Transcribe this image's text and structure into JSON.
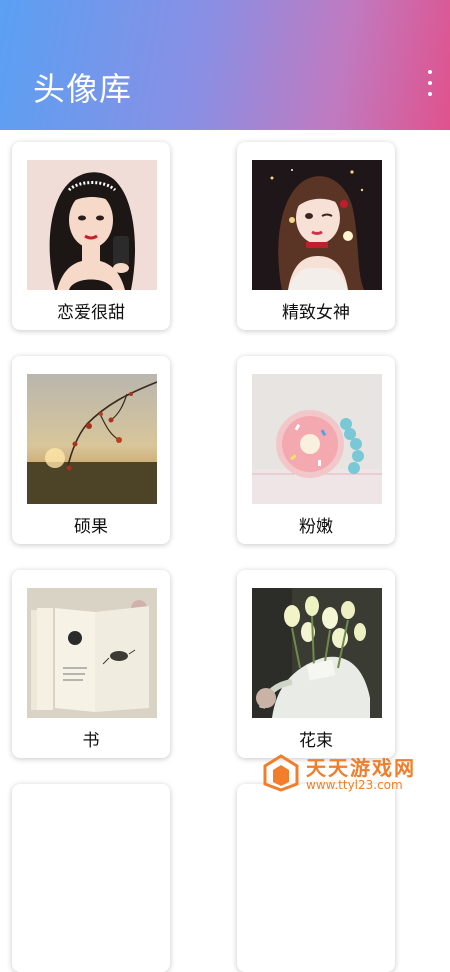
{
  "header": {
    "title": "头像库",
    "menu_icon": "more-vertical-icon"
  },
  "colors": {
    "gradient_start": "#5aa0f3",
    "gradient_end": "#e0528d",
    "watermark": "#f07e2b"
  },
  "cards": [
    {
      "label": "恋爱很甜"
    },
    {
      "label": "精致女神"
    },
    {
      "label": "硕果"
    },
    {
      "label": "粉嫩"
    },
    {
      "label": "书"
    },
    {
      "label": "花束"
    }
  ],
  "watermark": {
    "brand": "天天游戏网",
    "url": "www.ttyl23.com"
  }
}
